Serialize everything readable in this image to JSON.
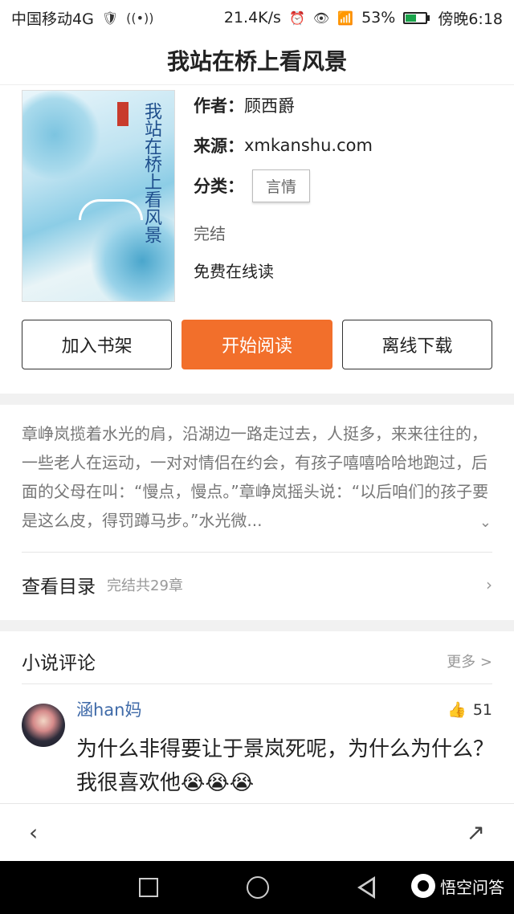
{
  "status_bar": {
    "carrier": "中国移动4G",
    "speed": "21.4K/s",
    "battery_percent": "53%",
    "battery_level": 0.53,
    "time": "傍晚6:18",
    "icons": [
      "shield-icon",
      "hotspot-icon",
      "signal-icon",
      "alarm-icon",
      "eye-icon",
      "wifi-icon",
      "battery-icon"
    ]
  },
  "header": {
    "title": "我站在桥上看风景"
  },
  "book": {
    "cover_title": "我站在桥上看风景",
    "author_label": "作者：",
    "author": "顾西爵",
    "source_label": "来源：",
    "source": "xmkanshu.com",
    "category_label": "分类：",
    "category": "言情",
    "status": "完结",
    "free_text": "免费在线读"
  },
  "actions": {
    "add_shelf": "加入书架",
    "start_read": "开始阅读",
    "offline_download": "离线下载",
    "accent_color": "#f26f2b"
  },
  "summary": {
    "text": "章峥岚揽着水光的肩，沿湖边一路走过去，人挺多，来来往往的，一些老人在运动，一对对情侣在约会，有孩子嘻嘻哈哈地跑过，后面的父母在叫：“慢点，慢点。”章峥岚摇头说：“以后咱们的孩子要是这么皮，得罚蹲马步。”水光微..."
  },
  "toc": {
    "label": "查看目录",
    "sub": "完结共29章"
  },
  "comments": {
    "title": "小说评论",
    "more": "更多 >",
    "items": [
      {
        "user": "涵han妈",
        "likes": "51",
        "text": "为什么非得要让于景岚死呢，为什么为什么？我很喜欢他😭😭😭"
      }
    ]
  },
  "bottom": {
    "back_icon": "back-icon",
    "share_icon": "share-icon"
  },
  "watermark": {
    "text": "悟空问答"
  }
}
